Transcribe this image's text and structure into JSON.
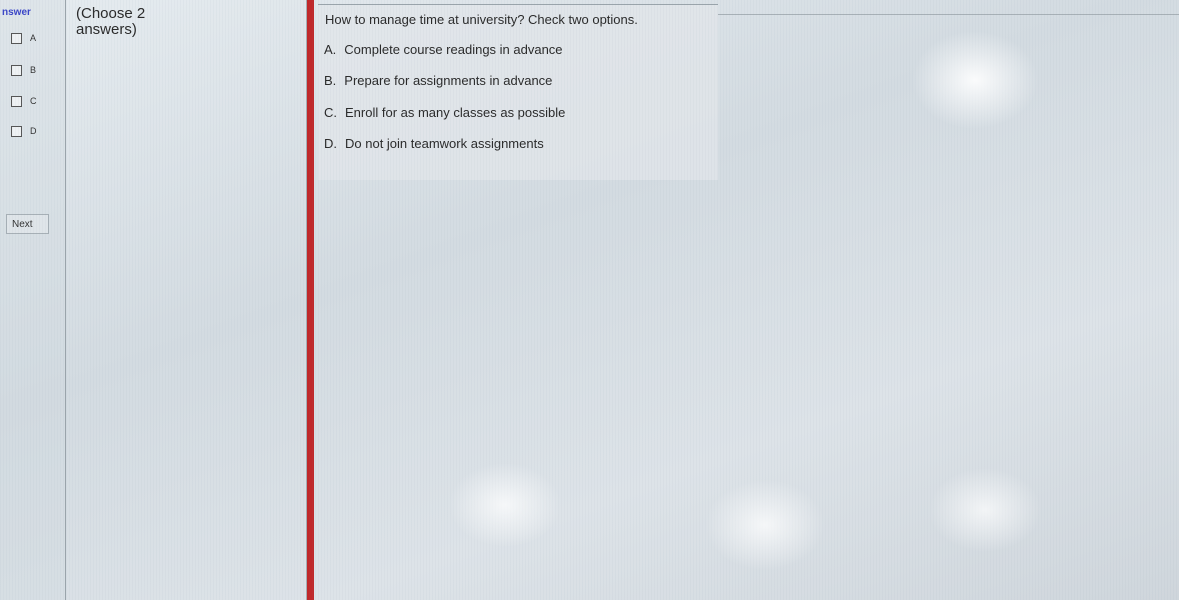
{
  "answer_panel": {
    "header": "nswer",
    "options": [
      {
        "letter": "A"
      },
      {
        "letter": "B"
      },
      {
        "letter": "C"
      },
      {
        "letter": "D"
      }
    ],
    "next_label": "Next"
  },
  "instructions": {
    "text": "(Choose 2 answers)"
  },
  "question": {
    "prompt": "How to manage time at university? Check two options.",
    "choices": [
      {
        "letter": "A.",
        "text": "Complete course readings in advance"
      },
      {
        "letter": "B.",
        "text": "Prepare for assignments in advance"
      },
      {
        "letter": "C.",
        "text": "Enroll for as many classes as possible"
      },
      {
        "letter": "D.",
        "text": "Do not join teamwork assignments"
      }
    ]
  },
  "colors": {
    "accent_bar": "#c0282a",
    "header_text": "#3a45c8"
  }
}
